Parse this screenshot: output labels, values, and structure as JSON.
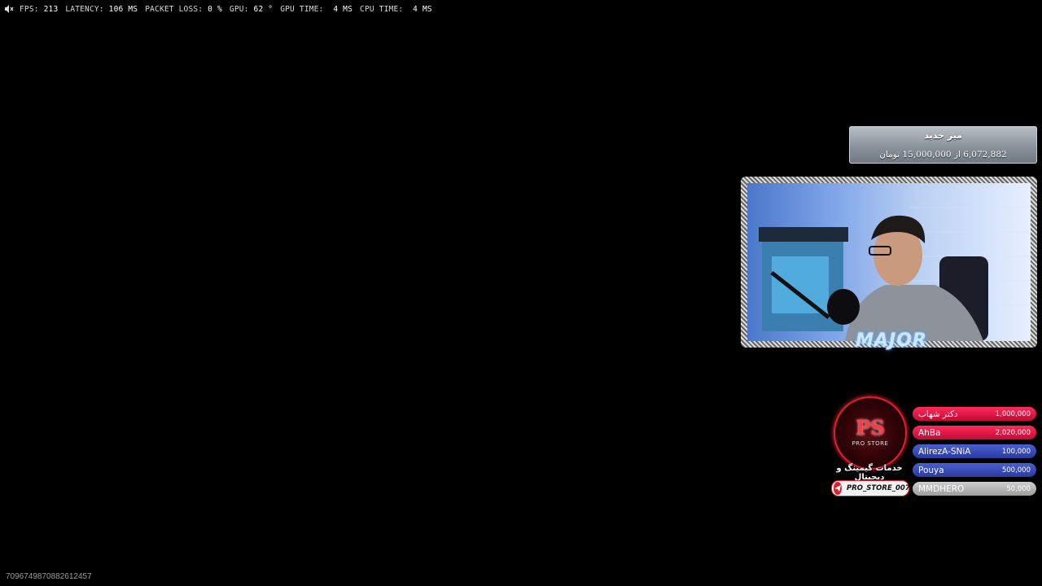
{
  "stats": {
    "fps_label": "FPS:",
    "fps": "213",
    "latency_label": "LATENCY:",
    "latency": "106 MS",
    "loss_label": "PACKET LOSS:",
    "loss": "0 %",
    "gpu_label": "GPU:",
    "gpu": "62 °",
    "gpu_time_label": "GPU TIME:",
    "gpu_time": "4 MS",
    "cpu_time_label": "CPU TIME:",
    "cpu_time": "4 MS"
  },
  "goal": {
    "title": "میز جدید",
    "progress": "6,072,882 از 15,000,000 تومان"
  },
  "overlay": {
    "streamer_logo": "MAJOR"
  },
  "sponsor": {
    "logo_text": "PS",
    "logo_sub": "PRO STORE",
    "caption": "خدمات گیمینگ و دیجیتال",
    "telegram_handle": "PRO_STORE_007"
  },
  "donors": [
    {
      "name": "دکتر شهاب",
      "amount": "1,000,000",
      "color": "red"
    },
    {
      "name": "AhBa",
      "amount": "2,020,000",
      "color": "red"
    },
    {
      "name": "AlirezA-SNiA",
      "amount": "100,000",
      "color": "blue"
    },
    {
      "name": "Pouya",
      "amount": "500,000",
      "color": "blue"
    },
    {
      "name": "MMDHERO",
      "amount": "50,000",
      "color": "gray"
    }
  ],
  "session_id": "7096749870882612457"
}
